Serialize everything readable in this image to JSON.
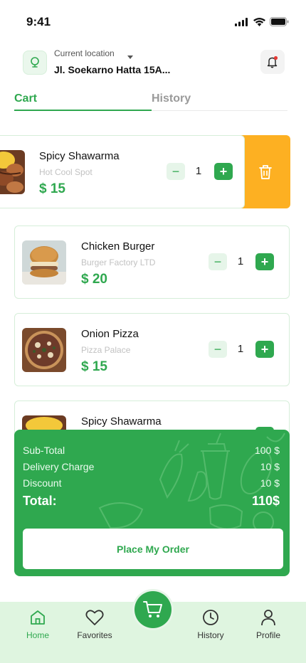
{
  "status": {
    "time": "9:41"
  },
  "location": {
    "label": "Current location",
    "value": "Jl. Soekarno Hatta 15A..."
  },
  "tabs": {
    "cart": "Cart",
    "history": "History"
  },
  "cart_items": [
    {
      "name": "Spicy Shawarma",
      "shop": "Hot Cool Spot",
      "price": "$ 15",
      "qty": "1",
      "image": "shawarma"
    },
    {
      "name": "Chicken Burger",
      "shop": "Burger Factory LTD",
      "price": "$ 20",
      "qty": "1",
      "image": "burger"
    },
    {
      "name": "Onion Pizza",
      "shop": "Pizza Palace",
      "price": "$ 15",
      "qty": "1",
      "image": "pizza"
    },
    {
      "name": "Spicy Shawarma",
      "image": "shawarma"
    }
  ],
  "summary": {
    "subtotal_label": "Sub-Total",
    "subtotal_value": "100 $",
    "delivery_label": "Delivery Charge",
    "delivery_value": "10 $",
    "discount_label": "Discount",
    "discount_value": "10 $",
    "total_label": "Total:",
    "total_value": "110$",
    "place_order": "Place My Order"
  },
  "nav": {
    "home": "Home",
    "favorites": "Favorites",
    "history": "History",
    "profile": "Profile"
  },
  "colors": {
    "primary": "#2fa84f",
    "delete": "#fdb022",
    "nav_bg": "#dff5e0"
  }
}
